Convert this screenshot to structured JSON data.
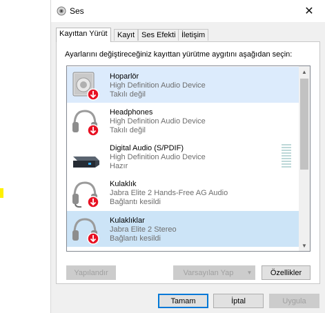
{
  "window": {
    "title": "Ses",
    "close_glyph": "✕"
  },
  "tabs": [
    {
      "label": "Kayıttan Yürüt",
      "active": true
    },
    {
      "label": "Kayıt",
      "active": false
    },
    {
      "label": "Ses Efekti",
      "active": false
    },
    {
      "label": "İletişim",
      "active": false
    }
  ],
  "instruction": "Ayarlarını değiştireceğiniz kayıttan yürütme aygıtını aşağıdan seçin:",
  "devices": [
    {
      "name": "Hoparlör",
      "device": "High Definition Audio Device",
      "status": "Takılı değil",
      "icon": "speaker-icon",
      "selected": "light"
    },
    {
      "name": "Headphones",
      "device": "High Definition Audio Device",
      "status": "Takılı değil",
      "icon": "headphones-icon",
      "selected": "none"
    },
    {
      "name": "Digital Audio (S/PDIF)",
      "device": "High Definition Audio Device",
      "status": "Hazır",
      "icon": "digital-audio-icon",
      "selected": "none"
    },
    {
      "name": "Kulaklık",
      "device": "Jabra Elite 2 Hands-Free AG Audio",
      "status": "Bağlantı kesildi",
      "icon": "headset-icon",
      "selected": "none"
    },
    {
      "name": "Kulaklıklar",
      "device": "Jabra Elite 2 Stereo",
      "status": "Bağlantı kesildi",
      "icon": "headphones-icon",
      "selected": "strong"
    }
  ],
  "buttons": {
    "configure": "Yapılandır",
    "set_default": "Varsayılan Yap",
    "properties": "Özellikler",
    "ok": "Tamam",
    "cancel": "İptal",
    "apply": "Uygula"
  },
  "colors": {
    "selection": "#cce4f7",
    "accent": "#0078d7",
    "disconnected_badge": "#e81123"
  }
}
